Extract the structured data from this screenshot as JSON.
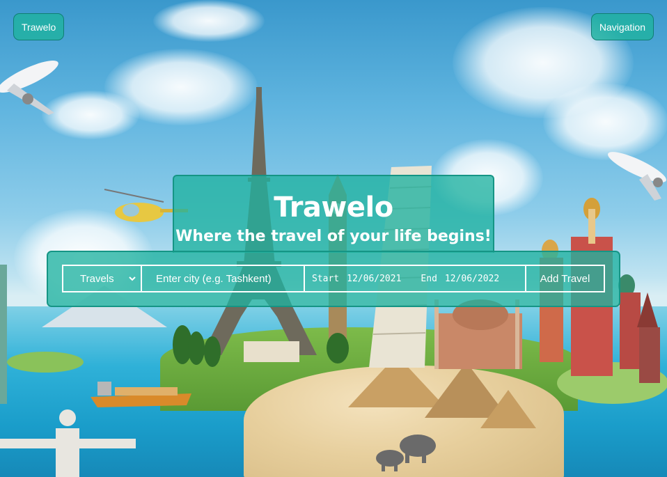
{
  "header": {
    "brand_label": "Trawelo",
    "nav_label": "Navigation"
  },
  "hero": {
    "title": "Trawelo",
    "subtitle": "Where the travel of your life begins!"
  },
  "form": {
    "category_selected": "Travels",
    "city_placeholder": "Enter city (e.g. Tashkent)",
    "start_label": "Start",
    "start_date": "12/06/2021",
    "end_label": "End",
    "end_date": "12/06/2022",
    "add_button_label": "Add Travel"
  },
  "colors": {
    "accent_teal": "#20b2a0",
    "accent_border": "#159585",
    "text": "#ffffff"
  },
  "icons": {
    "select_chevron": "chevron-down-icon"
  }
}
